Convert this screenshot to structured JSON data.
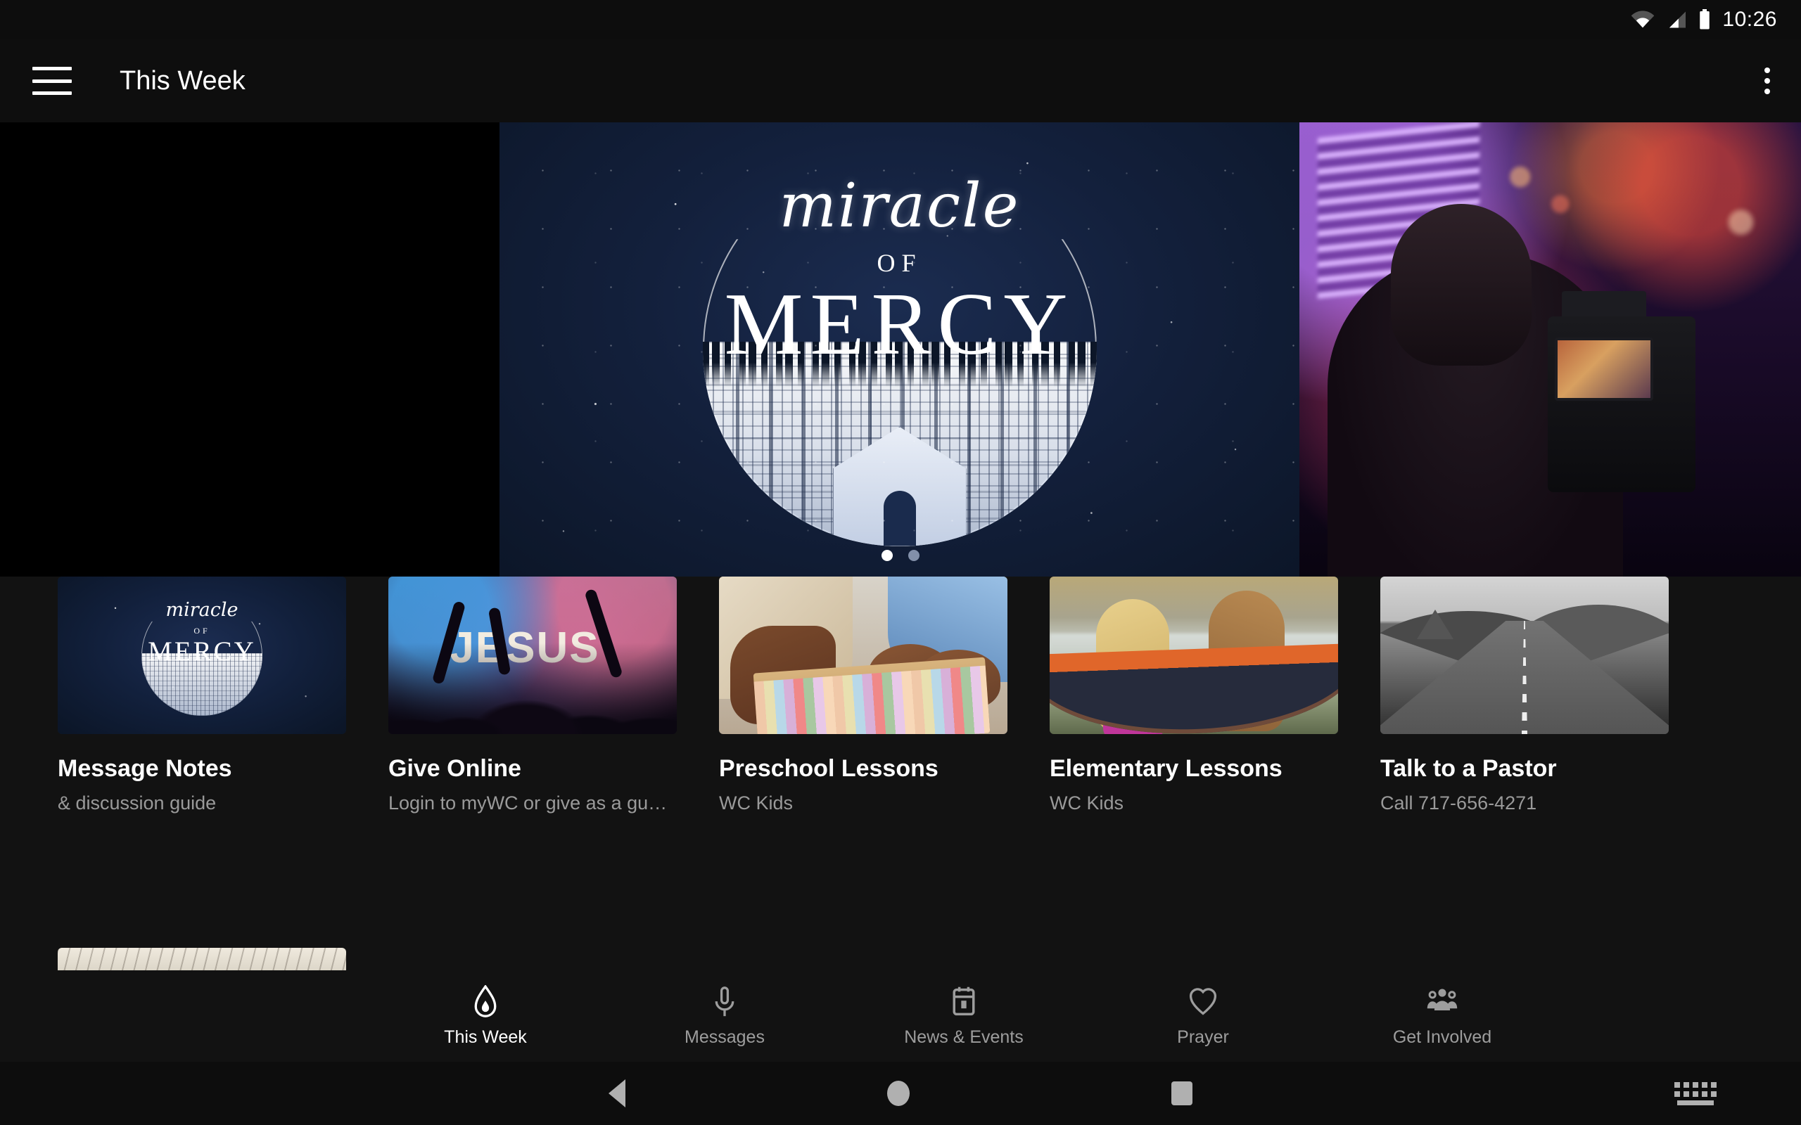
{
  "status_bar": {
    "time": "10:26",
    "icons": [
      "wifi-icon",
      "cellular-signal-icon",
      "battery-icon"
    ]
  },
  "app_bar": {
    "menu_icon": "hamburger-menu-icon",
    "title": "This Week",
    "overflow_icon": "more-vertical-icon"
  },
  "hero": {
    "slides": [
      {
        "name": "miracle-of-mercy",
        "script_word": "miracle",
        "of_word": "OF",
        "main_word": "MERCY"
      },
      {
        "name": "worship-camera-operator"
      }
    ],
    "pagination": {
      "total": 2,
      "active_index": 0
    }
  },
  "cards": [
    {
      "title": "Message Notes",
      "subtitle": "& discussion guide",
      "thumb": "miracle-of-mercy-thumb"
    },
    {
      "title": "Give Online",
      "subtitle": "Login to myWC or give as a gu…",
      "thumb": "jesus-worship-thumb"
    },
    {
      "title": "Preschool Lessons",
      "subtitle": "WC Kids",
      "thumb": "kids-chalk-thumb"
    },
    {
      "title": "Elementary Lessons",
      "subtitle": "WC Kids",
      "thumb": "hammock-girls-thumb"
    },
    {
      "title": "Talk to a Pastor",
      "subtitle": "Call 717-656-4271",
      "thumb": "open-road-bw-thumb"
    }
  ],
  "tabs": [
    {
      "label": "This Week",
      "icon": "flame-icon",
      "active": true
    },
    {
      "label": "Messages",
      "icon": "microphone-icon",
      "active": false
    },
    {
      "label": "News & Events",
      "icon": "calendar-icon",
      "active": false
    },
    {
      "label": "Prayer",
      "icon": "heart-icon",
      "active": false
    },
    {
      "label": "Get Involved",
      "icon": "people-group-icon",
      "active": false
    }
  ],
  "system_nav": {
    "back_icon": "back-triangle-icon",
    "home_icon": "home-circle-icon",
    "recents_icon": "recents-square-icon",
    "keyboard_icon": "keyboard-icon"
  },
  "colors": {
    "background": "#121212",
    "app_bar": "#0e0e0e",
    "accent_night": "#12203c",
    "active_tab": "#ffffff",
    "inactive_tab": "#9d9d9d"
  }
}
